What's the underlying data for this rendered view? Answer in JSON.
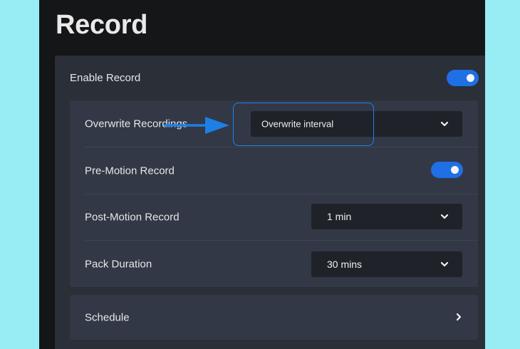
{
  "page": {
    "title": "Record"
  },
  "enable_record": {
    "label": "Enable Record",
    "enabled": true
  },
  "settings": {
    "overwrite": {
      "label": "Overwrite Recordings",
      "value": "Overwrite interval"
    },
    "pre_motion": {
      "label": "Pre-Motion Record",
      "enabled": true
    },
    "post_motion": {
      "label": "Post-Motion Record",
      "value": "1 min"
    },
    "pack_duration": {
      "label": "Pack Duration",
      "value": "30 mins"
    }
  },
  "schedule": {
    "label": "Schedule"
  },
  "icons": {
    "dropdown": "chevron-down-icon",
    "schedule": "chevron-right-icon",
    "callout": "arrow-right-icon"
  },
  "colors": {
    "accent": "#1f6fe5",
    "highlight": "#1e84ee",
    "background": "#98ecf3"
  }
}
